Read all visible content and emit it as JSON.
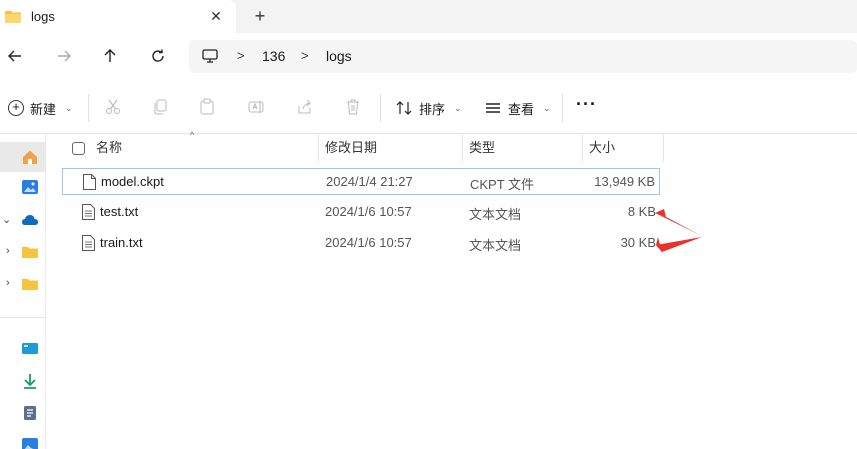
{
  "tab": {
    "title": "logs",
    "close": "✕",
    "new_tab": "+"
  },
  "nav": {
    "back": "←",
    "forward": "→",
    "up": "↑",
    "refresh": "⟳"
  },
  "address": {
    "sep1": ">",
    "crumb1": "136",
    "sep2": ">",
    "crumb2": "logs"
  },
  "commands": {
    "new_label": "新建",
    "sort_label": "排序",
    "view_label": "查看",
    "more": "···",
    "icons": [
      "cut-icon",
      "copy-icon",
      "paste-icon",
      "rename-icon",
      "share-icon",
      "delete-icon"
    ]
  },
  "columns": [
    "名称",
    "修改日期",
    "类型",
    "大小"
  ],
  "sort_indicator": "^",
  "files": [
    {
      "name": "model.ckpt",
      "date": "2024/1/4 21:27",
      "type": "CKPT 文件",
      "size": "13,949 KB"
    },
    {
      "name": "test.txt",
      "date": "2024/1/6 10:57",
      "type": "文本文档",
      "size": "8 KB"
    },
    {
      "name": "train.txt",
      "date": "2024/1/6 10:57",
      "type": "文本文档",
      "size": "30 KB"
    }
  ],
  "colors": {
    "accent": "#0f6cbd",
    "annotation": "#e8322a",
    "folder": "#f6c343",
    "selection_border": "#99c9ef"
  }
}
